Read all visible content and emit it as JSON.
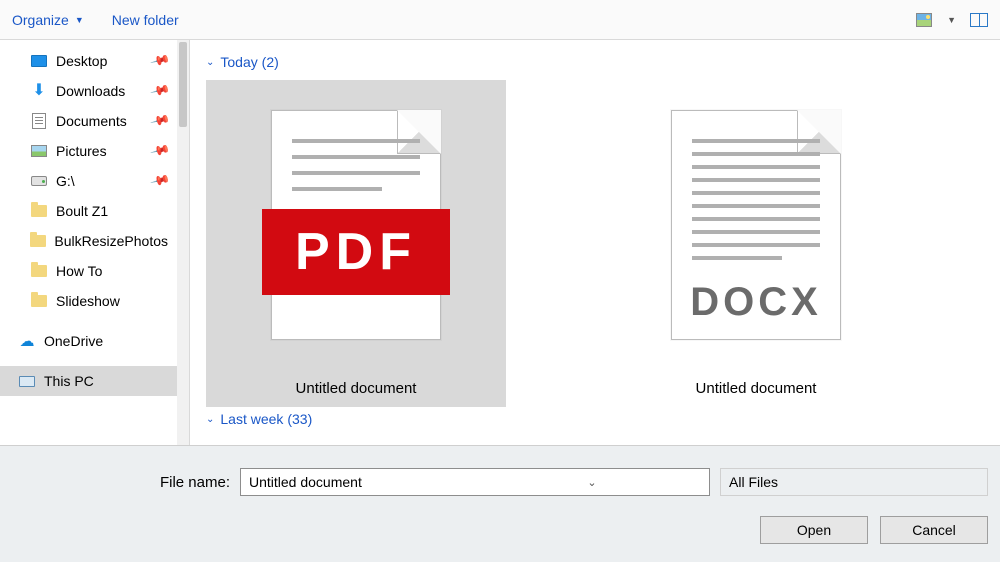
{
  "toolbar": {
    "organize": "Organize",
    "new_folder": "New folder"
  },
  "sidebar": {
    "quick": [
      {
        "label": "Desktop",
        "icon": "desktop",
        "pinned": true
      },
      {
        "label": "Downloads",
        "icon": "download",
        "pinned": true
      },
      {
        "label": "Documents",
        "icon": "doc",
        "pinned": true
      },
      {
        "label": "Pictures",
        "icon": "pic",
        "pinned": true
      },
      {
        "label": "G:\\",
        "icon": "drive",
        "pinned": true
      },
      {
        "label": "Boult Z1",
        "icon": "folder",
        "pinned": false
      },
      {
        "label": "BulkResizePhotos",
        "icon": "folder",
        "pinned": false
      },
      {
        "label": "How To",
        "icon": "folder",
        "pinned": false
      },
      {
        "label": "Slideshow",
        "icon": "folder",
        "pinned": false
      }
    ],
    "onedrive": "OneDrive",
    "thispc": "This PC"
  },
  "groups": {
    "today": {
      "label": "Today",
      "count": 2
    },
    "lastweek": {
      "label": "Last week",
      "count": 33
    }
  },
  "files": [
    {
      "name": "Untitled document",
      "type": "pdf",
      "selected": true
    },
    {
      "name": "Untitled document",
      "type": "docx",
      "selected": false
    }
  ],
  "pdf_band": "PDF",
  "docx_band": "DOCX",
  "bottom": {
    "filename_label": "File name:",
    "filename_value": "Untitled document",
    "filter": "All Files",
    "open": "Open",
    "cancel": "Cancel"
  }
}
